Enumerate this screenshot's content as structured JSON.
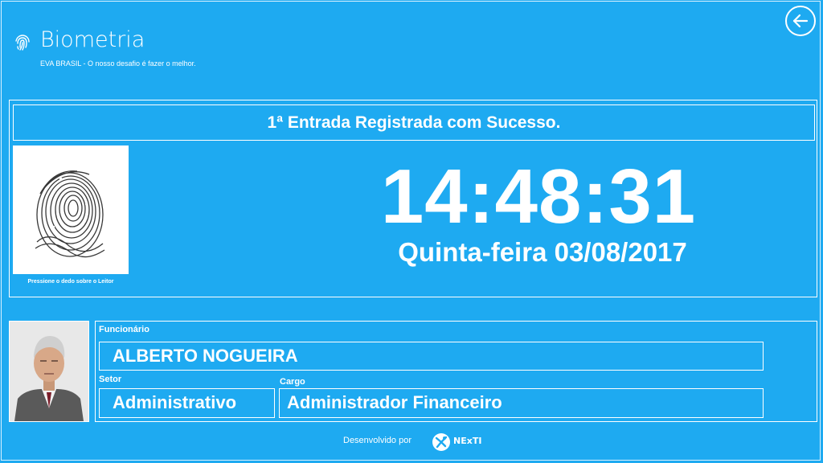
{
  "app": {
    "title": "Biometria",
    "subtitle": "EVA BRASIL - O nosso desafio é fazer o melhor."
  },
  "icons": {
    "app_logo": "fingerprint-icon",
    "back": "arrow-left-circle-icon",
    "developer_logo": "nexti-logo-icon"
  },
  "status": {
    "message": "1ª Entrada Registrada com Sucesso."
  },
  "fingerprint": {
    "caption": "Pressione o dedo sobre o Leitor"
  },
  "clock": {
    "time": "14:48:31",
    "date": "Quinta-feira 03/08/2017"
  },
  "employee": {
    "name_label": "Funcionário",
    "name": "ALBERTO NOGUEIRA",
    "sector_label": "Setor",
    "sector": "Administrativo",
    "role_label": "Cargo",
    "role": "Administrador Financeiro"
  },
  "footer": {
    "text": "Desenvolvido por",
    "brand": "NExTI"
  },
  "colors": {
    "background": "#1eaaf1",
    "foreground": "#ffffff"
  }
}
